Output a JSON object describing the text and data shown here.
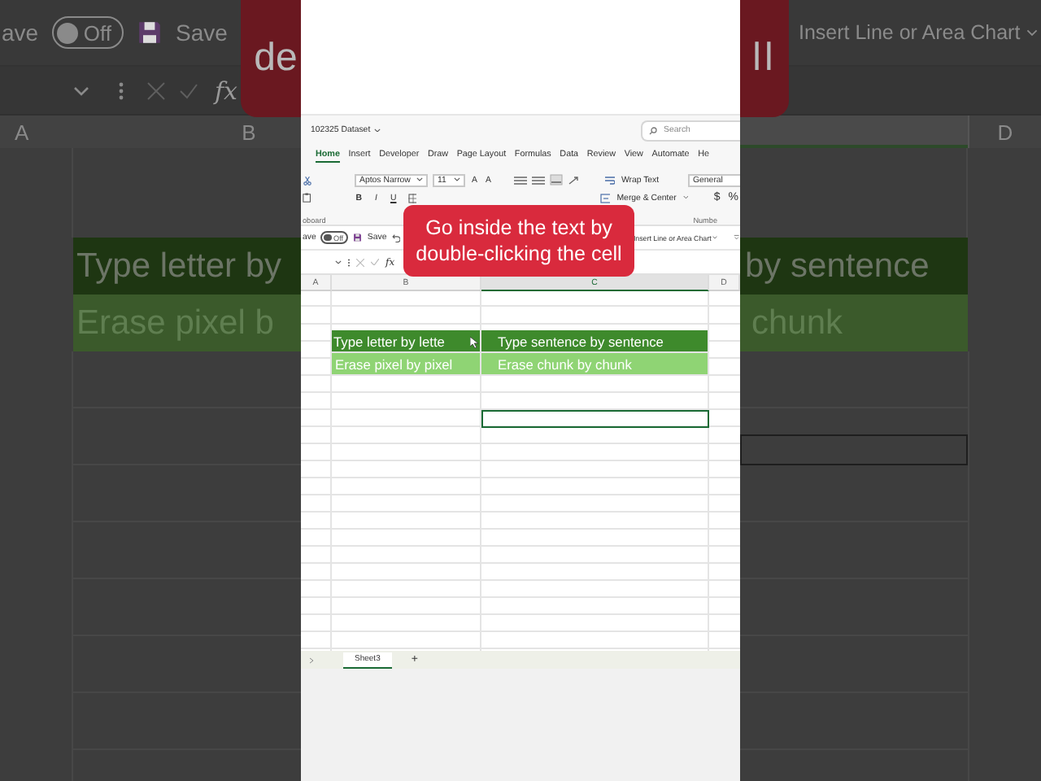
{
  "backdrop_left": {
    "autosave_label": "ave",
    "toggle": {
      "label": "Off",
      "on": false
    },
    "save_label": "Save",
    "function_label": "fx",
    "column_headers": [
      "A",
      "B"
    ],
    "cells": [
      "Type letter by",
      "Erase pixel b"
    ],
    "caption_fragment": "de"
  },
  "backdrop_right": {
    "chart_button": "Insert Line or Area Chart",
    "column_headers": [
      "D"
    ],
    "cells": [
      "by sentence",
      "chunk"
    ],
    "caption_fragment": "ll"
  },
  "workbook": {
    "file_name": "102325 Dataset",
    "search": {
      "placeholder": "Search"
    },
    "tabs": [
      {
        "label": "Home",
        "selected": true
      },
      {
        "label": "Insert",
        "selected": false
      },
      {
        "label": "Developer",
        "selected": false
      },
      {
        "label": "Draw",
        "selected": false
      },
      {
        "label": "Page Layout",
        "selected": false
      },
      {
        "label": "Formulas",
        "selected": false
      },
      {
        "label": "Data",
        "selected": false
      },
      {
        "label": "Review",
        "selected": false
      },
      {
        "label": "View",
        "selected": false
      },
      {
        "label": "Automate",
        "selected": false
      },
      {
        "label": "He",
        "selected": false
      }
    ],
    "ribbon": {
      "font_name": "Aptos Narrow",
      "font_size": "11",
      "font_size_buttons": [
        "A",
        "A"
      ],
      "format_buttons": [
        "B",
        "I",
        "U"
      ],
      "wrap_text": "Wrap Text",
      "merge_center": "Merge & Center",
      "number_format": "General",
      "number_buttons": [
        "$",
        "%"
      ],
      "group_labels": [
        "oboard",
        "Numbe"
      ]
    },
    "quick_access": {
      "autosave_label": "ave",
      "toggle": {
        "label": "Off",
        "on": false
      },
      "save_label": "Save",
      "chart_button": "Insert Line or Area Chart"
    },
    "formula_bar": {
      "function_label": "fx"
    },
    "columns": [
      {
        "label": "A",
        "selected": false
      },
      {
        "label": "B",
        "selected": false
      },
      {
        "label": "C",
        "selected": true
      },
      {
        "label": "D",
        "selected": false
      }
    ],
    "table": [
      {
        "kind": "header",
        "cells": [
          "Type letter by lette",
          "Type sentence by sentence"
        ]
      },
      {
        "kind": "body",
        "cells": [
          "Erase pixel by pixel",
          "Erase chunk by chunk"
        ]
      }
    ],
    "sheets": [
      {
        "label": "Sheet3",
        "selected": true
      }
    ],
    "add_sheet": "+"
  },
  "caption": "Go inside the text by double-clicking the cell"
}
